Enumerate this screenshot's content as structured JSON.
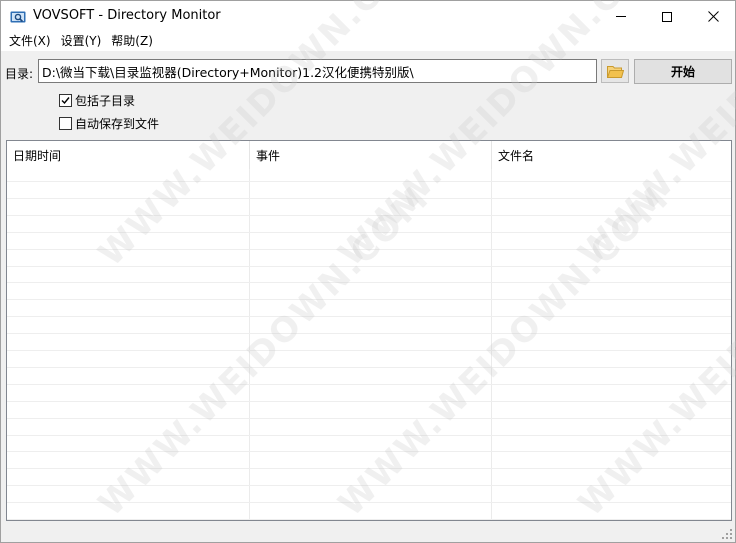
{
  "window": {
    "title": "VOVSOFT - Directory Monitor"
  },
  "menu": [
    "文件(X)",
    "设置(Y)",
    "帮助(Z)"
  ],
  "directory": {
    "label": "目录:",
    "value": "D:\\微当下载\\目录监视器(Directory+Monitor)1.2汉化便携特别版\\"
  },
  "buttons": {
    "start_label": "开始"
  },
  "options": [
    {
      "label": "包括子目录",
      "checked": true
    },
    {
      "label": "自动保存到文件",
      "checked": false
    }
  ],
  "table": {
    "columns": [
      "日期时间",
      "事件",
      "文件名"
    ],
    "rows": []
  },
  "watermark": "WWW.WEIDOWN.COM",
  "colors": {
    "folder_icon": "#f2c14e",
    "app_icon": "#2f6fb5"
  },
  "icons": {
    "browse": "folder-icon",
    "app": "app-icon"
  }
}
